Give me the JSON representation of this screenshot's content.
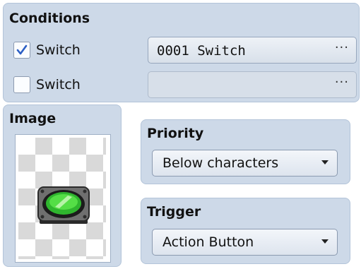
{
  "conditions": {
    "title": "Conditions",
    "switch1": {
      "label": "Switch",
      "checked": true,
      "value": "0001 Switch",
      "button": "···"
    },
    "switch2": {
      "label": "Switch",
      "checked": false,
      "value": "",
      "button": "···"
    }
  },
  "image": {
    "title": "Image",
    "sprite_icon": "green-switch-button-icon"
  },
  "priority": {
    "title": "Priority",
    "selected": "Below characters"
  },
  "trigger": {
    "title": "Trigger",
    "selected": "Action Button"
  },
  "colors": {
    "panel": "#cdd9e8",
    "accent_check": "#2c5fc4",
    "sprite_green": "#39c93a"
  }
}
